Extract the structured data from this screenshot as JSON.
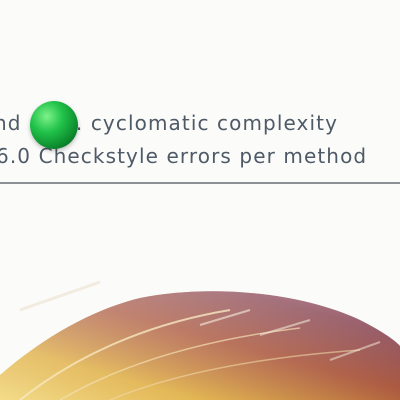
{
  "document": {
    "line_1": "nd max. cyclomatic complexity",
    "line_2": "6.0 Checkstyle errors per method"
  },
  "icons": {
    "status_marker": "green-ball-icon",
    "background_artwork": "feather-graphic"
  },
  "colors": {
    "text": "#4e5a66",
    "rule": "#8d9094",
    "marker_green": "#21c34a",
    "feather_maroon": "#7a2f3e",
    "feather_gold": "#e2b653"
  }
}
